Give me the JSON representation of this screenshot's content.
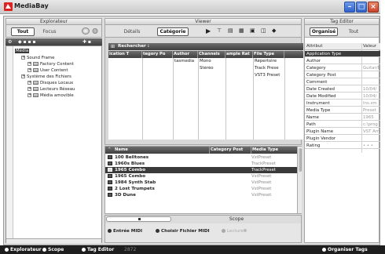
{
  "window": {
    "title": "MediaBay",
    "icons": {
      "app": "steinberg-logo-icon",
      "minimize": "minimize-icon",
      "maximize": "maximize-icon",
      "close": "close-icon"
    }
  },
  "explorer": {
    "header": "Explorateur",
    "tabs": [
      "Tout",
      "Focus"
    ],
    "tree": [
      {
        "label": "Média",
        "level": 0,
        "selected": true
      },
      {
        "label": "Sound Frame",
        "level": 1
      },
      {
        "label": "Factory Content",
        "level": 2
      },
      {
        "label": "User Content",
        "level": 2
      },
      {
        "label": "Système des Fichiers",
        "level": 1
      },
      {
        "label": "Disques Locaux",
        "level": 2
      },
      {
        "label": "Lecteurs Réseau",
        "level": 2
      },
      {
        "label": "Média amovible",
        "level": 2
      }
    ]
  },
  "viewer": {
    "header": "Viewer",
    "tabs": [
      "Détails",
      "Catégorie"
    ],
    "search_label": "Rechercher :",
    "filter_columns": [
      "ication T",
      "tegory Po",
      "Author",
      "Channels",
      "ample Rat",
      "File Type"
    ],
    "filter_rows": [
      [
        "",
        "",
        "tasmedia",
        "Mono",
        "",
        "Répertoire"
      ],
      [
        "",
        "",
        "",
        "Stéréo",
        "",
        "Track Prese"
      ],
      [
        "",
        "",
        "",
        "",
        "",
        "VST3 Preset"
      ]
    ],
    "result_columns": [
      "Name",
      "Category Post",
      "Media Type"
    ],
    "results": [
      {
        "name": "100 Belltones",
        "type": "VstPreset"
      },
      {
        "name": "1960s Blues",
        "type": "TrackPreset"
      },
      {
        "name": "1965 Combo",
        "type": "TrackPreset",
        "selected": true
      },
      {
        "name": "1965 Combo",
        "type": "VstPreset"
      },
      {
        "name": "1984 Synth Stab",
        "type": "VstPreset"
      },
      {
        "name": "2 Lost Trumpets",
        "type": "VstPreset"
      },
      {
        "name": "3D Dune",
        "type": "VstPreset"
      }
    ]
  },
  "scope": {
    "header": "Scope",
    "midi_in": "Entrée MIDI",
    "midi_file": "Choisir Fichier MIDI",
    "play": "Lecture"
  },
  "tag_editor": {
    "header": "Tag Editor",
    "tabs": [
      "Organisé",
      "Tout"
    ],
    "columns": [
      "Attribut",
      "Valeur"
    ],
    "rows": [
      {
        "k": "Application Type",
        "v": "",
        "sel": true
      },
      {
        "k": "Author",
        "v": ""
      },
      {
        "k": "Category",
        "v": "Guitar/P"
      },
      {
        "k": "Category Post",
        "v": ""
      },
      {
        "k": "Comment",
        "v": ""
      },
      {
        "k": "Date Created",
        "v": "10/04/"
      },
      {
        "k": "Date Modified",
        "v": "10/04/"
      },
      {
        "k": "Instrument",
        "v": "Ins.sm"
      },
      {
        "k": "Media Type",
        "v": "Preset"
      },
      {
        "k": "Name",
        "v": "1965"
      },
      {
        "k": "Path",
        "v": "c:\\prog"
      },
      {
        "k": "Plugin Name",
        "v": "VST Am"
      },
      {
        "k": "Plugin Vendor",
        "v": ""
      },
      {
        "k": "Rating",
        "v": "• • •"
      }
    ]
  },
  "statusbar": {
    "explorer": "Explorateur",
    "scope": "Scope",
    "tag_editor": "Tag Editor",
    "count": "2872",
    "organize": "Organiser Tags"
  }
}
